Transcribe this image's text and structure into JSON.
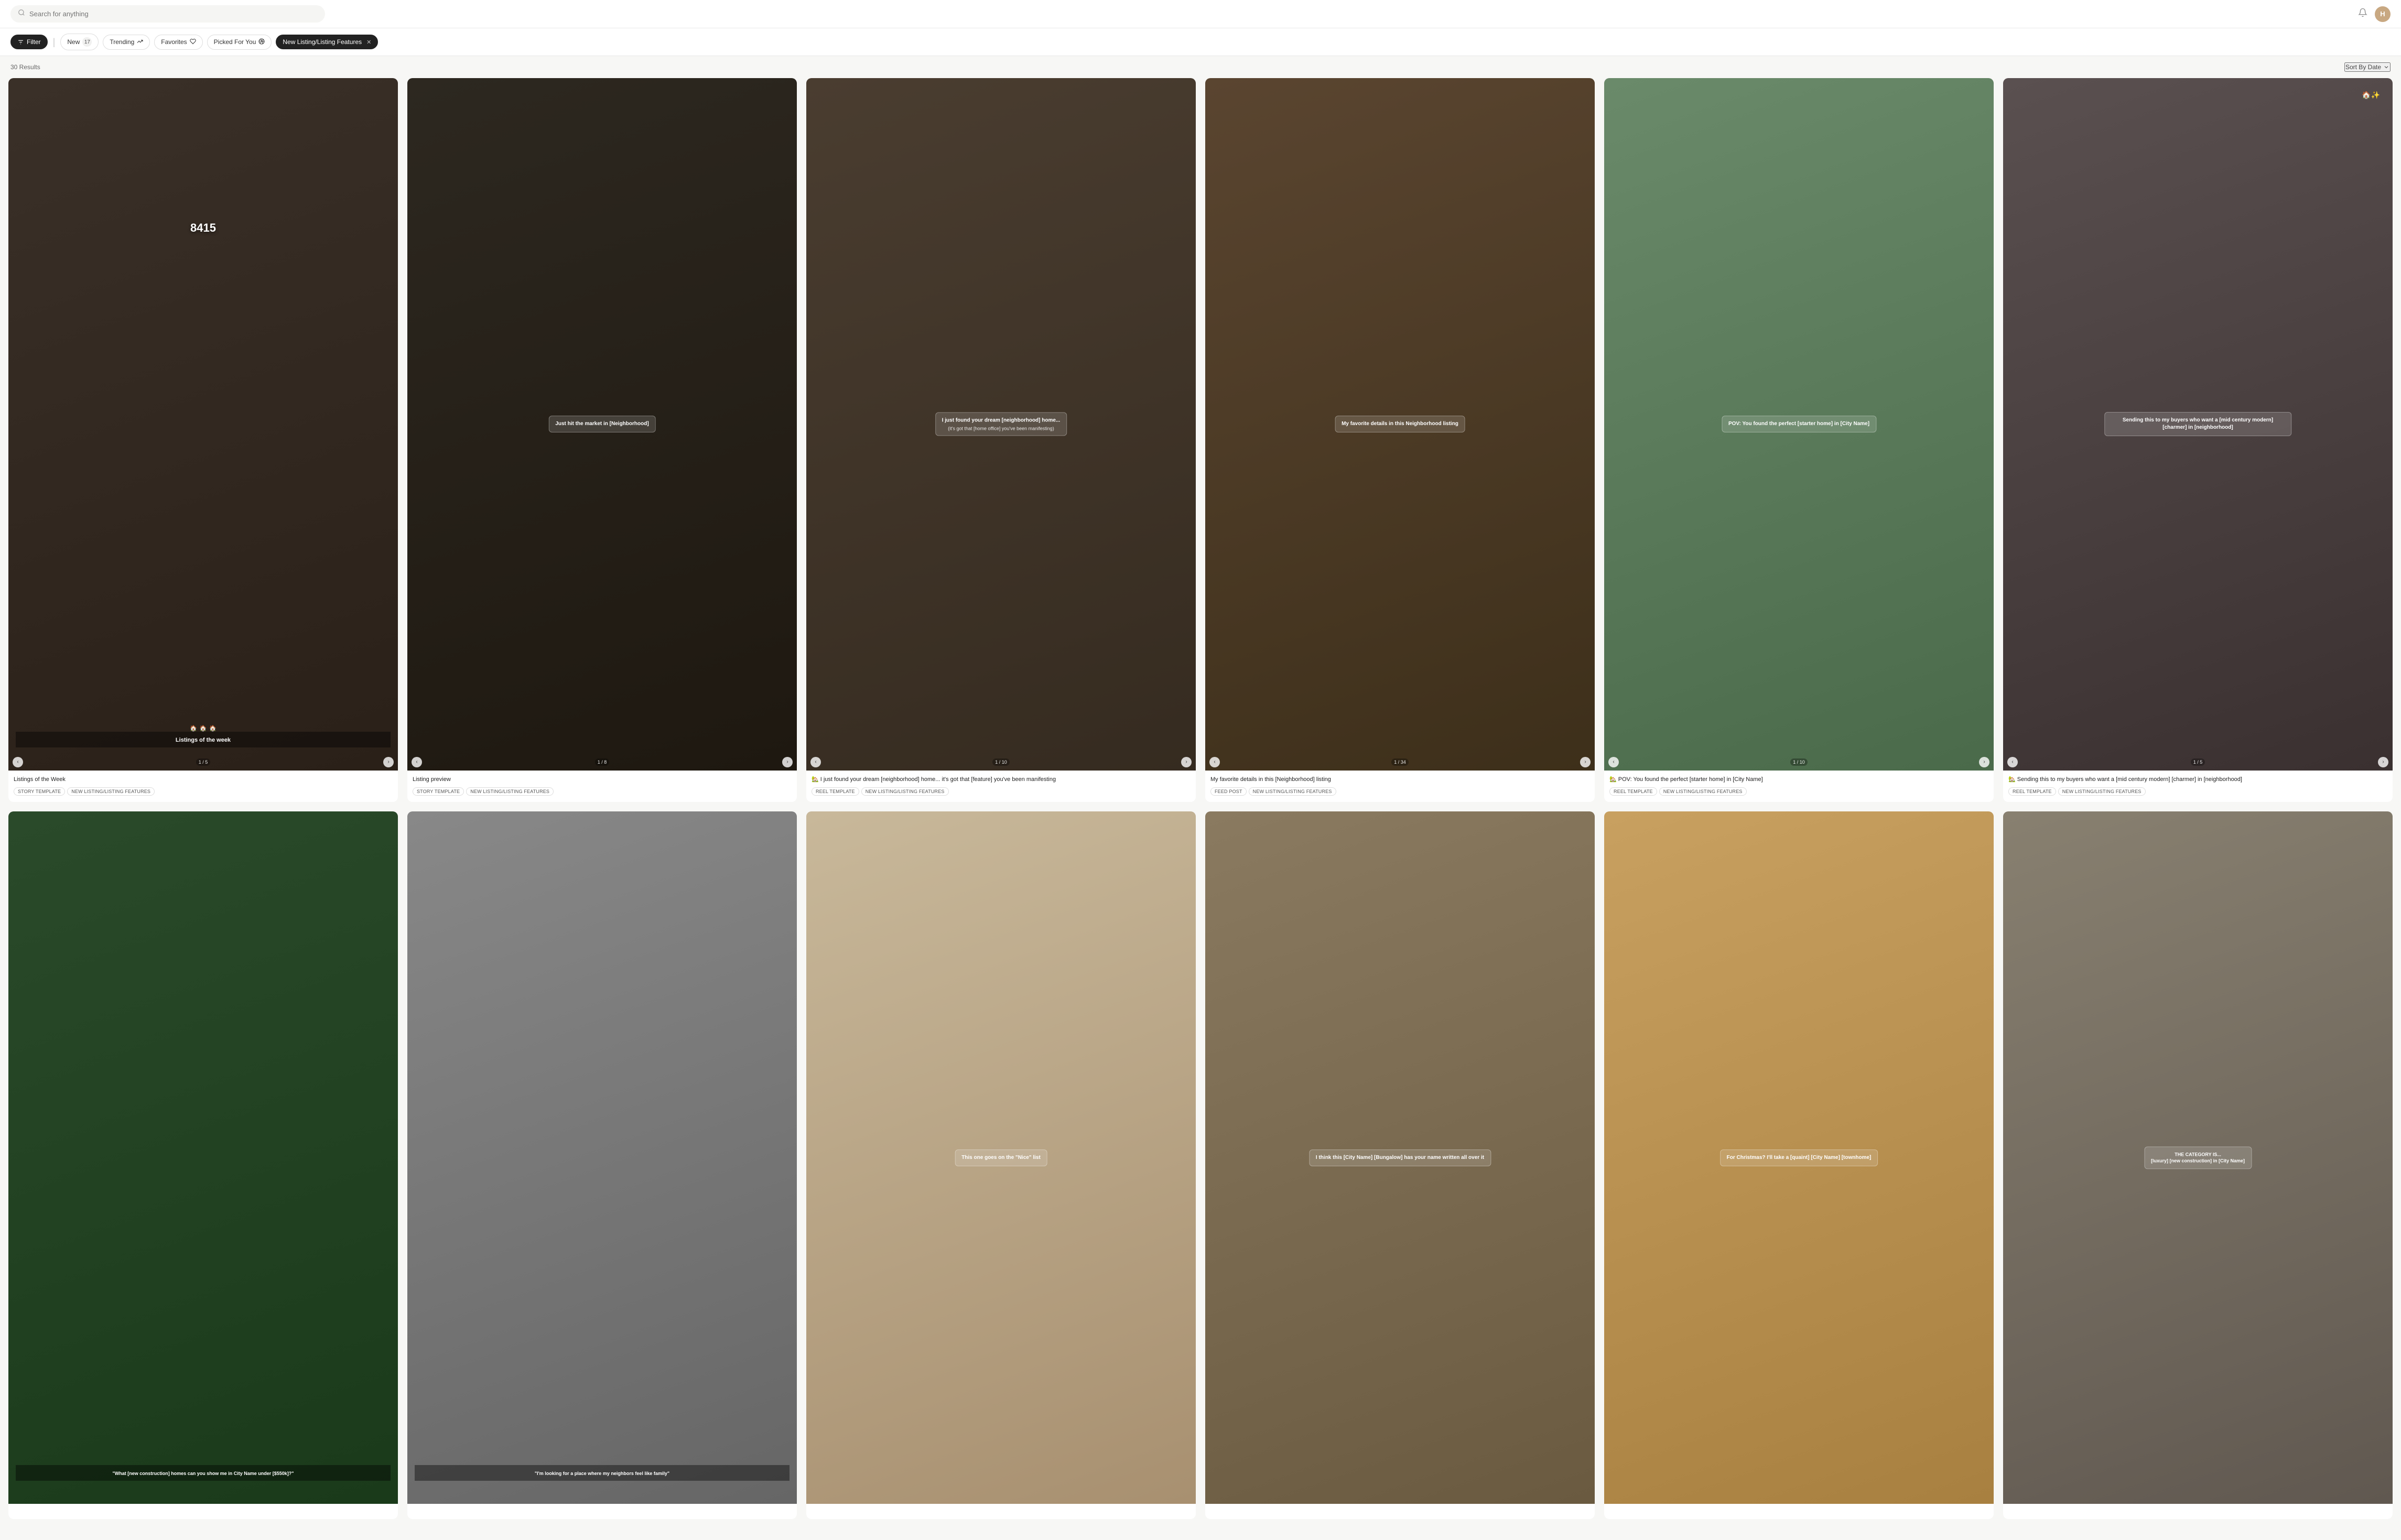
{
  "topbar": {
    "search_placeholder": "Search for anything",
    "avatar_initials": "H"
  },
  "filters": {
    "filter_label": "Filter",
    "items": [
      {
        "id": "new",
        "label": "New",
        "count": 17,
        "active": false
      },
      {
        "id": "trending",
        "label": "Trending",
        "active": false
      },
      {
        "id": "favorites",
        "label": "Favorites",
        "active": false
      },
      {
        "id": "picked-for-you",
        "label": "Picked For You",
        "active": false
      },
      {
        "id": "new-listing",
        "label": "New Listing/Listing Features",
        "active": true,
        "removable": true
      }
    ]
  },
  "results": {
    "count": "30 Results",
    "sort_label": "Sort By Date"
  },
  "cards": [
    {
      "id": 1,
      "title": "Listings of the Week",
      "overlay": "Listings of the week",
      "nav_current": 1,
      "nav_total": 5,
      "bg": "dark-arch",
      "tags": [
        "STORY TEMPLATE",
        "NEW LISTING/LISTING FEATURES"
      ],
      "address": "8415",
      "has_nav": true
    },
    {
      "id": 2,
      "title": "Listing preview",
      "overlay": "Just hit the market in [Neighborhood]",
      "nav_current": 1,
      "nav_total": 8,
      "bg": "kitchen",
      "tags": [
        "STORY TEMPLATE",
        "NEW LISTING/LISTING FEATURES"
      ],
      "has_nav": true
    },
    {
      "id": 3,
      "title": "🏡 I just found your dream [neighborhood] home... it's got that [feature] you've been manifesting",
      "overlay_main": "I just found your dream [neighborhood] home...",
      "overlay_sub": "(it's got that [home office] you've been manifesting)",
      "nav_current": 1,
      "nav_total": 10,
      "bg": "livingroom",
      "tags": [
        "REEL TEMPLATE",
        "NEW LISTING/LISTING FEATURES"
      ],
      "has_nav": true
    },
    {
      "id": 4,
      "title": "My favorite details in this [Neighborhood] listing",
      "overlay": "My favorite details in this Neighborhood listing",
      "nav_current": 1,
      "nav_total": 34,
      "bg": "beams",
      "tags": [
        "FEED POST",
        "NEW LISTING/LISTING FEATURES"
      ],
      "has_nav": true
    },
    {
      "id": 5,
      "title": "🏡 POV: You found the perfect [starter home] in [City Name]",
      "overlay": "POV: You found the perfect [starter home] in [City Name]",
      "nav_current": 1,
      "nav_total": 10,
      "bg": "exterior",
      "tags": [
        "REEL TEMPLATE",
        "NEW LISTING/LISTING FEATURES"
      ],
      "has_nav": true
    },
    {
      "id": 6,
      "title": "🏡 Sending this to my buyers who want a [mid century modern] [charmer] in [neighborhood]",
      "overlay": "Sending this to my buyers who want a [mid century modern] [charmer] in [neighborhood]",
      "nav_current": 1,
      "nav_total": 5,
      "bg": "modern",
      "tags": [
        "REEL TEMPLATE",
        "NEW LISTING/LISTING FEATURES"
      ],
      "has_nav": true
    },
    {
      "id": 7,
      "title": "",
      "overlay": "\"What [new construction] homes can you show me in City Name under [$550k]?\"",
      "nav_current": null,
      "nav_total": null,
      "bg": "market",
      "tags": [],
      "has_nav": false
    },
    {
      "id": 8,
      "title": "",
      "overlay": "\"I'm looking for a place where my neighbors feel like family\"",
      "nav_current": null,
      "nav_total": null,
      "bg": "gray-house",
      "tags": [],
      "has_nav": false
    },
    {
      "id": 9,
      "title": "",
      "overlay": "This one goes on the \"Nice\" list",
      "nav_current": null,
      "nav_total": null,
      "bg": "arch2",
      "tags": [],
      "has_nav": false
    },
    {
      "id": 10,
      "title": "",
      "overlay": "I think this [City Name] [Bungalow] has your name written all over it",
      "nav_current": null,
      "nav_total": null,
      "bg": "plant",
      "tags": [],
      "has_nav": false
    },
    {
      "id": 11,
      "title": "",
      "overlay": "For Christmas? I'll take a [quaint] [City Name] [townhome]",
      "nav_current": null,
      "nav_total": null,
      "bg": "xmas",
      "tags": [],
      "has_nav": false
    },
    {
      "id": 12,
      "title": "",
      "overlay": "THE CATEGORY IS... [luxury] [new construction] in [City Name]",
      "nav_current": null,
      "nav_total": null,
      "bg": "luxury",
      "tags": [],
      "has_nav": false
    }
  ]
}
